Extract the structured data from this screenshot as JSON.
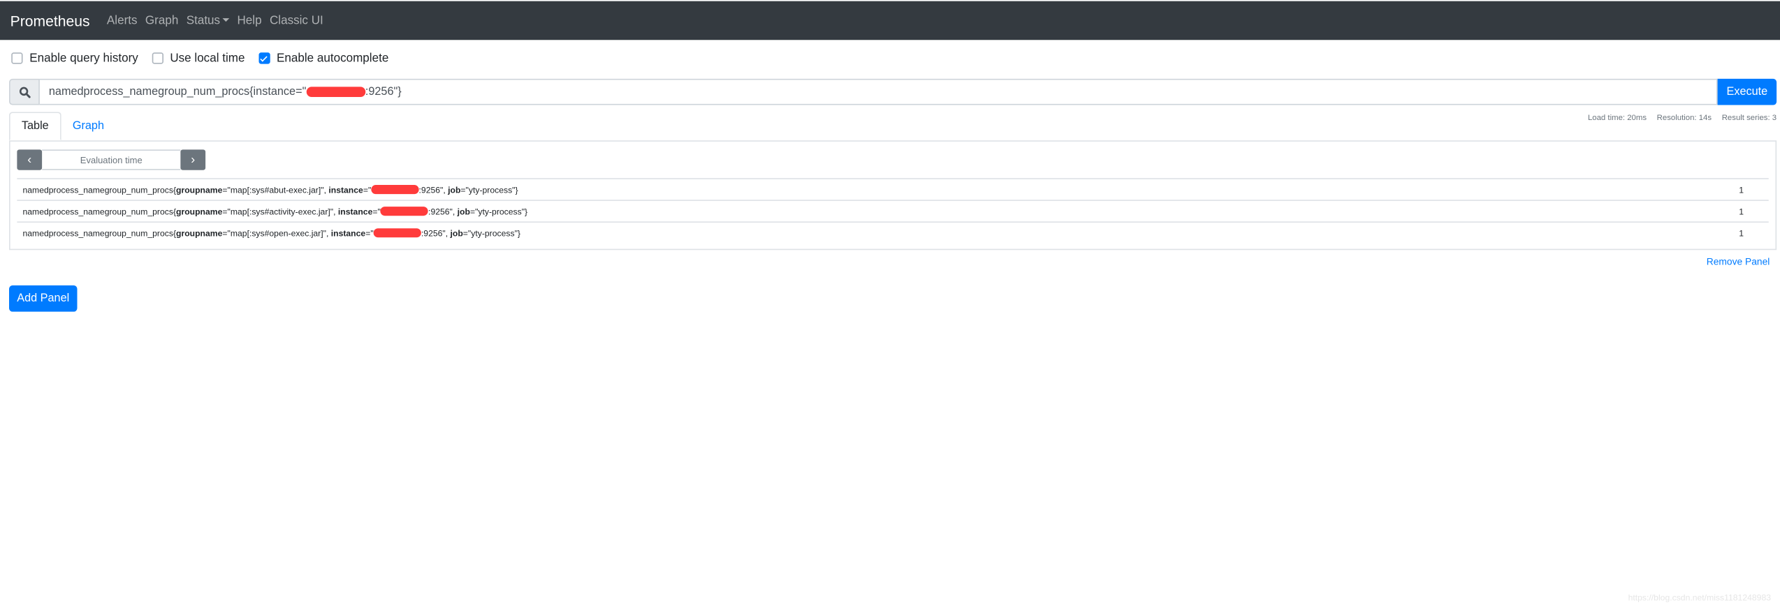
{
  "navbar": {
    "brand": "Prometheus",
    "links": [
      "Alerts",
      "Graph",
      "Status",
      "Help",
      "Classic UI"
    ]
  },
  "options": [
    {
      "label": "Enable query history",
      "checked": false
    },
    {
      "label": "Use local time",
      "checked": false
    },
    {
      "label": "Enable autocomplete",
      "checked": true
    }
  ],
  "query": {
    "prefix": "namedprocess_namegroup_num_procs{instance=\"",
    "suffix": ":9256\"}",
    "execute_label": "Execute",
    "icon": "search-icon"
  },
  "tabs": [
    {
      "label": "Table",
      "active": true
    },
    {
      "label": "Graph",
      "active": false
    }
  ],
  "stats": {
    "load_time": "Load time: 20ms",
    "resolution": "Resolution: 14s",
    "result_series": "Result series: 3"
  },
  "eval_time": {
    "placeholder": "Evaluation time"
  },
  "results": [
    {
      "metric": "namedprocess_namegroup_num_procs{",
      "groupname": "\"map[:sys#abut-exec.jar]\"",
      "instance_suffix": ":9256\"",
      "job": "\"yty-process\"}",
      "value": "1"
    },
    {
      "metric": "namedprocess_namegroup_num_procs{",
      "groupname": "\"map[:sys#activity-exec.jar]\"",
      "instance_suffix": ":9256\"",
      "job": "\"yty-process\"}",
      "value": "1"
    },
    {
      "metric": "namedprocess_namegroup_num_procs{",
      "groupname": "\"map[:sys#open-exec.jar]\"",
      "instance_suffix": ":9256\"",
      "job": "\"yty-process\"}",
      "value": "1"
    }
  ],
  "labels": {
    "groupname": "groupname",
    "instance": "instance",
    "job": "job"
  },
  "remove_panel": "Remove Panel",
  "add_panel": "Add Panel",
  "watermark": "https://blog.csdn.net/miss1181248983"
}
